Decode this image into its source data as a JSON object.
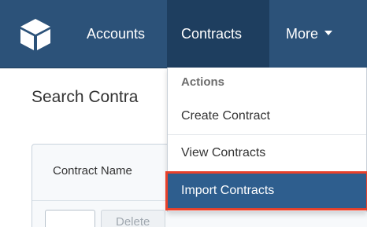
{
  "nav": {
    "logo_icon": "cube-icon",
    "items": [
      "Accounts",
      "Contracts",
      "More"
    ],
    "more_icon": "caret-down-icon",
    "bar_color": "#2c5279",
    "active_color": "#1e3e5f"
  },
  "main": {
    "title": "Search Contra",
    "column_header": "Contract Name",
    "delete_label": "Delete"
  },
  "dropdown": {
    "header": "Actions",
    "items": [
      "Create Contract",
      "View Contracts",
      "Import Contracts"
    ],
    "highlight_color": "#2e5e8e",
    "highlight_border": "#e8412b"
  }
}
